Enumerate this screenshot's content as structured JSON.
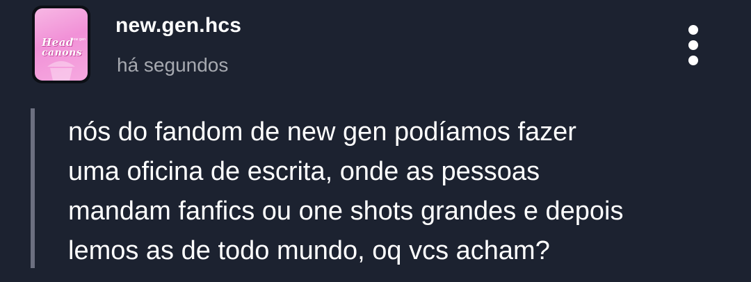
{
  "post": {
    "avatar": {
      "line1": "Head",
      "line2": "canons",
      "small": "new gen",
      "colors": {
        "background": "#f191d7",
        "accent": "#c4479c"
      }
    },
    "username": "new.gen.hcs",
    "timestamp": "há segundos",
    "menu_icon": "vertical-ellipsis-icon",
    "body": "nós do fandom de new gen podíamos fazer\numa oficina de escrita, onde as pessoas\nmandam fanfics ou one shots grandes e depois\nlemos as de todo mundo, oq vcs acham?"
  },
  "theme": {
    "background": "#1c2230",
    "text": "#ffffff",
    "muted": "#a6a9b0",
    "quote_bar": "#6c7080"
  }
}
